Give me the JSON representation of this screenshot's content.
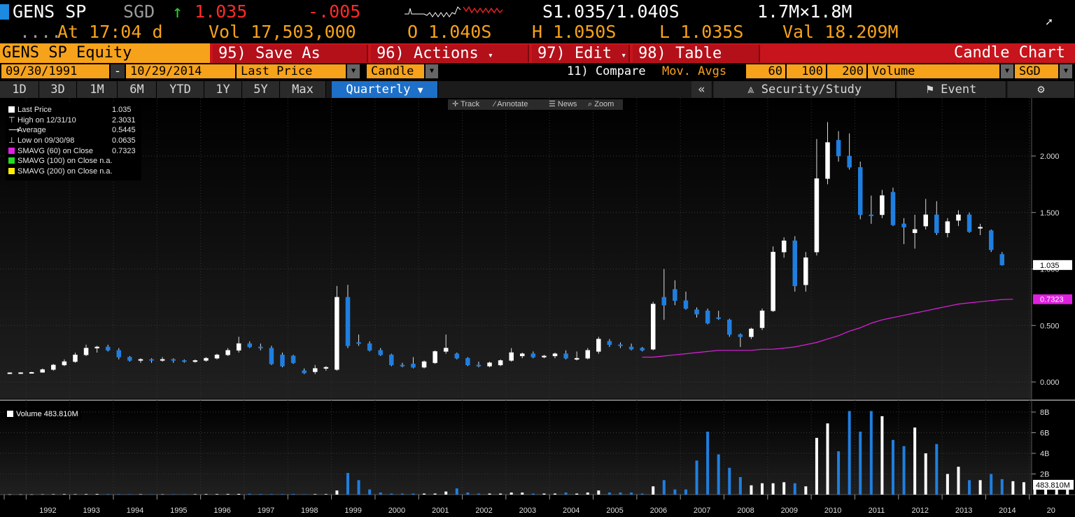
{
  "header": {
    "ticker": "GENS SP",
    "currency": "SGD",
    "arrow": "↑",
    "last": "1.035",
    "change": "-.005",
    "bid_ask": "S1.035/1.040S",
    "size": "1.7M×1.8M",
    "dots": "....",
    "time": "At 17:04 d",
    "volume": "Vol 17,503,000",
    "open": "O 1.040S",
    "high": "H 1.050S",
    "low": "L 1.035S",
    "value": "Val 18.209M"
  },
  "menu": {
    "title": "GENS SP Equity",
    "save": "95) Save As",
    "actions": "96) Actions",
    "actions_arrow": "▾",
    "edit": "97) Edit",
    "edit_arrow": "▾",
    "table": "98) Table",
    "chart_type_label": "Candle Chart"
  },
  "controls": {
    "start_date": "09/30/1991",
    "dash": "-",
    "end_date": "10/29/2014",
    "field": "Last Price",
    "style": "Candle",
    "compare": "11) Compare",
    "mov_avgs": "Mov. Avgs",
    "ma1": "60",
    "ma2": "100",
    "ma3": "200",
    "lower": "Volume",
    "currency": "SGD"
  },
  "tabs": [
    "1D",
    "3D",
    "1M",
    "6M",
    "YTD",
    "1Y",
    "5Y",
    "Max",
    "Quarterly"
  ],
  "active_tab": "Quarterly",
  "right_tabs": {
    "collapse": "«",
    "security_study": "Security/Study",
    "event": "Event"
  },
  "toolstrip": {
    "track": "Track",
    "annotate": "Annotate",
    "news": "News",
    "zoom": "Zoom"
  },
  "legend": {
    "rows": [
      {
        "label": "Last Price",
        "value": "1.035"
      },
      {
        "label": "High on 12/31/10",
        "value": "2.3031"
      },
      {
        "label": "Average",
        "value": "0.5445"
      },
      {
        "label": "Low on 09/30/98",
        "value": "0.0635"
      },
      {
        "label": "SMAVG (60) on Close",
        "value": "0.7323"
      },
      {
        "label": "SMAVG (100) on Close",
        "value": "n.a."
      },
      {
        "label": "SMAVG (200) on Close",
        "value": "n.a."
      }
    ],
    "volume_label": "Volume 483.810M"
  },
  "colors": {
    "up": "#ffffff",
    "down": "#1f7fe0",
    "smavg60": "#e020e0",
    "smavg100": "#22dd22",
    "smavg200": "#ffee00",
    "accent": "#f7a21b",
    "menu_red": "#c8141c"
  },
  "chart_data": {
    "type": "candlestick",
    "x_start": "1991 Q3",
    "x_frequency": "quarterly",
    "x_ticks": [
      "1992",
      "1993",
      "1994",
      "1995",
      "1996",
      "1997",
      "1998",
      "1999",
      "2000",
      "2001",
      "2002",
      "2003",
      "2004",
      "2005",
      "2006",
      "2007",
      "2008",
      "2009",
      "2010",
      "2011",
      "2012",
      "2013",
      "2014",
      "20"
    ],
    "y_ticks": [
      "0.000",
      "0.500",
      "1.000",
      "1.500",
      "2.000"
    ],
    "ylim": [
      -0.05,
      2.4
    ],
    "last_price_label": "1.035",
    "smavg_label": "0.7323",
    "candles": [
      {
        "o": 0.08,
        "h": 0.085,
        "l": 0.075,
        "c": 0.082
      },
      {
        "o": 0.082,
        "h": 0.085,
        "l": 0.078,
        "c": 0.083
      },
      {
        "o": 0.083,
        "h": 0.09,
        "l": 0.08,
        "c": 0.085
      },
      {
        "o": 0.085,
        "h": 0.12,
        "l": 0.083,
        "c": 0.11
      },
      {
        "o": 0.11,
        "h": 0.16,
        "l": 0.1,
        "c": 0.15
      },
      {
        "o": 0.15,
        "h": 0.2,
        "l": 0.14,
        "c": 0.18
      },
      {
        "o": 0.18,
        "h": 0.26,
        "l": 0.17,
        "c": 0.24
      },
      {
        "o": 0.24,
        "h": 0.33,
        "l": 0.23,
        "c": 0.3
      },
      {
        "o": 0.3,
        "h": 0.32,
        "l": 0.26,
        "c": 0.31
      },
      {
        "o": 0.31,
        "h": 0.33,
        "l": 0.27,
        "c": 0.28
      },
      {
        "o": 0.28,
        "h": 0.3,
        "l": 0.2,
        "c": 0.22
      },
      {
        "o": 0.22,
        "h": 0.23,
        "l": 0.18,
        "c": 0.19
      },
      {
        "o": 0.19,
        "h": 0.21,
        "l": 0.17,
        "c": 0.2
      },
      {
        "o": 0.2,
        "h": 0.21,
        "l": 0.17,
        "c": 0.19
      },
      {
        "o": 0.19,
        "h": 0.22,
        "l": 0.18,
        "c": 0.2
      },
      {
        "o": 0.2,
        "h": 0.21,
        "l": 0.17,
        "c": 0.19
      },
      {
        "o": 0.19,
        "h": 0.2,
        "l": 0.17,
        "c": 0.18
      },
      {
        "o": 0.18,
        "h": 0.2,
        "l": 0.17,
        "c": 0.19
      },
      {
        "o": 0.19,
        "h": 0.22,
        "l": 0.18,
        "c": 0.21
      },
      {
        "o": 0.21,
        "h": 0.25,
        "l": 0.2,
        "c": 0.24
      },
      {
        "o": 0.24,
        "h": 0.3,
        "l": 0.23,
        "c": 0.28
      },
      {
        "o": 0.28,
        "h": 0.4,
        "l": 0.26,
        "c": 0.34
      },
      {
        "o": 0.34,
        "h": 0.36,
        "l": 0.3,
        "c": 0.31
      },
      {
        "o": 0.31,
        "h": 0.34,
        "l": 0.28,
        "c": 0.3
      },
      {
        "o": 0.3,
        "h": 0.32,
        "l": 0.15,
        "c": 0.16
      },
      {
        "o": 0.24,
        "h": 0.26,
        "l": 0.13,
        "c": 0.14
      },
      {
        "o": 0.23,
        "h": 0.24,
        "l": 0.16,
        "c": 0.17
      },
      {
        "o": 0.1,
        "h": 0.12,
        "l": 0.07,
        "c": 0.08
      },
      {
        "o": 0.09,
        "h": 0.15,
        "l": 0.07,
        "c": 0.12
      },
      {
        "o": 0.12,
        "h": 0.14,
        "l": 0.1,
        "c": 0.13
      },
      {
        "o": 0.11,
        "h": 0.85,
        "l": 0.1,
        "c": 0.75
      },
      {
        "o": 0.75,
        "h": 0.86,
        "l": 0.3,
        "c": 0.32
      },
      {
        "o": 0.35,
        "h": 0.42,
        "l": 0.32,
        "c": 0.34
      },
      {
        "o": 0.34,
        "h": 0.36,
        "l": 0.27,
        "c": 0.28
      },
      {
        "o": 0.28,
        "h": 0.3,
        "l": 0.23,
        "c": 0.24
      },
      {
        "o": 0.24,
        "h": 0.25,
        "l": 0.14,
        "c": 0.15
      },
      {
        "o": 0.15,
        "h": 0.17,
        "l": 0.13,
        "c": 0.14
      },
      {
        "o": 0.16,
        "h": 0.22,
        "l": 0.12,
        "c": 0.13
      },
      {
        "o": 0.13,
        "h": 0.19,
        "l": 0.12,
        "c": 0.18
      },
      {
        "o": 0.17,
        "h": 0.28,
        "l": 0.16,
        "c": 0.27
      },
      {
        "o": 0.27,
        "h": 0.42,
        "l": 0.25,
        "c": 0.3
      },
      {
        "o": 0.25,
        "h": 0.26,
        "l": 0.2,
        "c": 0.21
      },
      {
        "o": 0.21,
        "h": 0.22,
        "l": 0.14,
        "c": 0.15
      },
      {
        "o": 0.15,
        "h": 0.18,
        "l": 0.13,
        "c": 0.14
      },
      {
        "o": 0.14,
        "h": 0.18,
        "l": 0.13,
        "c": 0.17
      },
      {
        "o": 0.15,
        "h": 0.2,
        "l": 0.14,
        "c": 0.19
      },
      {
        "o": 0.19,
        "h": 0.3,
        "l": 0.18,
        "c": 0.26
      },
      {
        "o": 0.23,
        "h": 0.26,
        "l": 0.21,
        "c": 0.25
      },
      {
        "o": 0.25,
        "h": 0.27,
        "l": 0.21,
        "c": 0.22
      },
      {
        "o": 0.22,
        "h": 0.24,
        "l": 0.21,
        "c": 0.23
      },
      {
        "o": 0.23,
        "h": 0.26,
        "l": 0.21,
        "c": 0.25
      },
      {
        "o": 0.25,
        "h": 0.28,
        "l": 0.2,
        "c": 0.21
      },
      {
        "o": 0.2,
        "h": 0.27,
        "l": 0.19,
        "c": 0.21
      },
      {
        "o": 0.21,
        "h": 0.3,
        "l": 0.2,
        "c": 0.28
      },
      {
        "o": 0.27,
        "h": 0.4,
        "l": 0.25,
        "c": 0.38
      },
      {
        "o": 0.36,
        "h": 0.38,
        "l": 0.31,
        "c": 0.33
      },
      {
        "o": 0.33,
        "h": 0.35,
        "l": 0.3,
        "c": 0.32
      },
      {
        "o": 0.31,
        "h": 0.34,
        "l": 0.28,
        "c": 0.29
      },
      {
        "o": 0.3,
        "h": 0.31,
        "l": 0.27,
        "c": 0.28
      },
      {
        "o": 0.29,
        "h": 0.71,
        "l": 0.28,
        "c": 0.69
      },
      {
        "o": 0.75,
        "h": 1.0,
        "l": 0.55,
        "c": 0.68
      },
      {
        "o": 0.82,
        "h": 0.9,
        "l": 0.68,
        "c": 0.72
      },
      {
        "o": 0.72,
        "h": 0.8,
        "l": 0.64,
        "c": 0.65
      },
      {
        "o": 0.64,
        "h": 0.66,
        "l": 0.57,
        "c": 0.6
      },
      {
        "o": 0.63,
        "h": 0.65,
        "l": 0.51,
        "c": 0.52
      },
      {
        "o": 0.57,
        "h": 0.63,
        "l": 0.55,
        "c": 0.56
      },
      {
        "o": 0.55,
        "h": 0.56,
        "l": 0.4,
        "c": 0.42
      },
      {
        "o": 0.42,
        "h": 0.43,
        "l": 0.31,
        "c": 0.4
      },
      {
        "o": 0.4,
        "h": 0.48,
        "l": 0.38,
        "c": 0.47
      },
      {
        "o": 0.48,
        "h": 0.65,
        "l": 0.46,
        "c": 0.63
      },
      {
        "o": 0.63,
        "h": 1.2,
        "l": 0.62,
        "c": 1.15
      },
      {
        "o": 1.15,
        "h": 1.28,
        "l": 1.1,
        "c": 1.25
      },
      {
        "o": 1.25,
        "h": 1.29,
        "l": 0.8,
        "c": 0.85
      },
      {
        "o": 0.86,
        "h": 1.15,
        "l": 0.8,
        "c": 1.1
      },
      {
        "o": 1.15,
        "h": 2.15,
        "l": 1.12,
        "c": 1.8
      },
      {
        "o": 1.8,
        "h": 2.3,
        "l": 1.75,
        "c": 2.12
      },
      {
        "o": 2.14,
        "h": 2.22,
        "l": 1.95,
        "c": 2.0
      },
      {
        "o": 2.0,
        "h": 2.2,
        "l": 1.88,
        "c": 1.9
      },
      {
        "o": 1.9,
        "h": 1.95,
        "l": 1.44,
        "c": 1.48
      },
      {
        "o": 1.48,
        "h": 1.65,
        "l": 1.4,
        "c": 1.47
      },
      {
        "o": 1.48,
        "h": 1.7,
        "l": 1.45,
        "c": 1.65
      },
      {
        "o": 1.68,
        "h": 1.72,
        "l": 1.38,
        "c": 1.39
      },
      {
        "o": 1.4,
        "h": 1.45,
        "l": 1.22,
        "c": 1.37
      },
      {
        "o": 1.32,
        "h": 1.48,
        "l": 1.18,
        "c": 1.35
      },
      {
        "o": 1.38,
        "h": 1.62,
        "l": 1.35,
        "c": 1.48
      },
      {
        "o": 1.48,
        "h": 1.6,
        "l": 1.3,
        "c": 1.32
      },
      {
        "o": 1.32,
        "h": 1.45,
        "l": 1.28,
        "c": 1.42
      },
      {
        "o": 1.43,
        "h": 1.52,
        "l": 1.38,
        "c": 1.48
      },
      {
        "o": 1.48,
        "h": 1.5,
        "l": 1.32,
        "c": 1.33
      },
      {
        "o": 1.36,
        "h": 1.4,
        "l": 1.3,
        "c": 1.37
      },
      {
        "o": 1.34,
        "h": 1.35,
        "l": 1.15,
        "c": 1.17
      },
      {
        "o": 1.13,
        "h": 1.15,
        "l": 1.03,
        "c": 1.035
      }
    ],
    "smavg60_start_index": 58,
    "smavg60": [
      0.22,
      0.22,
      0.23,
      0.24,
      0.25,
      0.26,
      0.27,
      0.28,
      0.28,
      0.28,
      0.28,
      0.29,
      0.29,
      0.3,
      0.31,
      0.33,
      0.35,
      0.38,
      0.41,
      0.45,
      0.48,
      0.52,
      0.55,
      0.57,
      0.59,
      0.61,
      0.63,
      0.65,
      0.67,
      0.69,
      0.7,
      0.71,
      0.72,
      0.73,
      0.7323
    ],
    "volume": {
      "ylim": [
        0,
        8.8
      ],
      "y_ticks": [
        "2B",
        "4B",
        "6B",
        "8B"
      ],
      "last_label": "483.810M",
      "values_B": [
        0.02,
        0.02,
        0.02,
        0.03,
        0.04,
        0.05,
        0.04,
        0.05,
        0.06,
        0.05,
        0.05,
        0.04,
        0.04,
        0.03,
        0.03,
        0.04,
        0.03,
        0.04,
        0.05,
        0.05,
        0.06,
        0.07,
        0.08,
        0.06,
        0.05,
        0.05,
        0.06,
        0.04,
        0.05,
        0.05,
        0.4,
        2.1,
        1.4,
        0.5,
        0.2,
        0.1,
        0.1,
        0.1,
        0.1,
        0.1,
        0.3,
        0.6,
        0.2,
        0.1,
        0.1,
        0.1,
        0.2,
        0.2,
        0.1,
        0.1,
        0.1,
        0.2,
        0.1,
        0.2,
        0.4,
        0.2,
        0.2,
        0.2,
        0.1,
        0.8,
        1.4,
        0.5,
        0.5,
        3.3,
        6.1,
        3.9,
        2.6,
        1.7,
        0.9,
        1.1,
        1.1,
        1.2,
        1.1,
        0.8,
        5.5,
        6.9,
        4.2,
        8.1,
        6.1,
        8.1,
        7.6,
        5.3,
        4.7,
        6.5,
        4.0,
        4.9,
        2.0,
        2.7,
        1.4,
        1.4,
        2.0,
        1.5,
        1.3,
        1.2,
        1.0,
        1.1,
        1.1,
        0.48
      ]
    }
  }
}
